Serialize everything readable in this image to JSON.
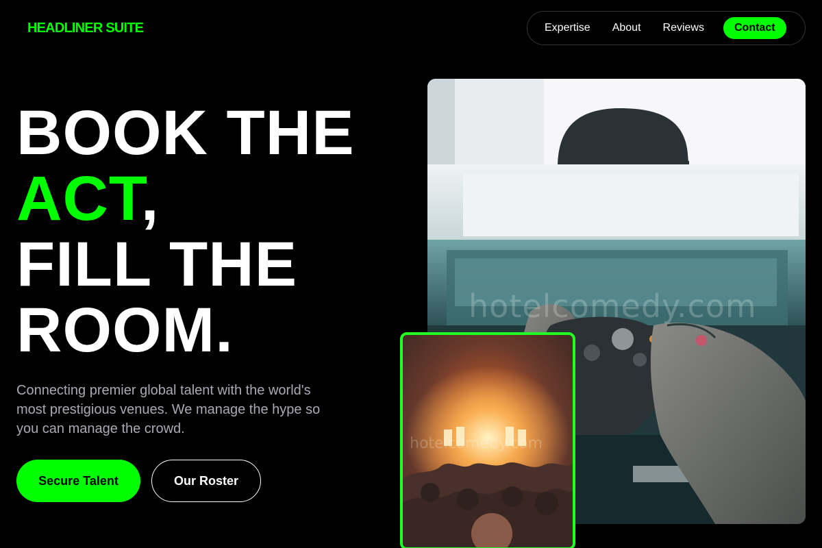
{
  "brand": {
    "name": "HEADLINER SUITE",
    "accent_color": "#00ff00"
  },
  "nav": {
    "links": [
      "Expertise",
      "About",
      "Reviews"
    ],
    "contact_label": "Contact"
  },
  "hero": {
    "line1": "BOOK THE",
    "line2_accent": "ACT",
    "line2_rest": ",",
    "line3": "FILL THE",
    "line4": "ROOM.",
    "subtext": "Connecting premier global talent with the world's most prestigious venues. We manage the hype so you can manage the crowd.",
    "primary_cta": "Secure Talent",
    "secondary_cta": "Our Roster"
  },
  "images": {
    "main_alt": "gaming controller photo",
    "main_watermark": "hotelcomedy.com",
    "concert_alt": "concert crowd photo",
    "concert_watermark": "hotelcomedy.com"
  }
}
